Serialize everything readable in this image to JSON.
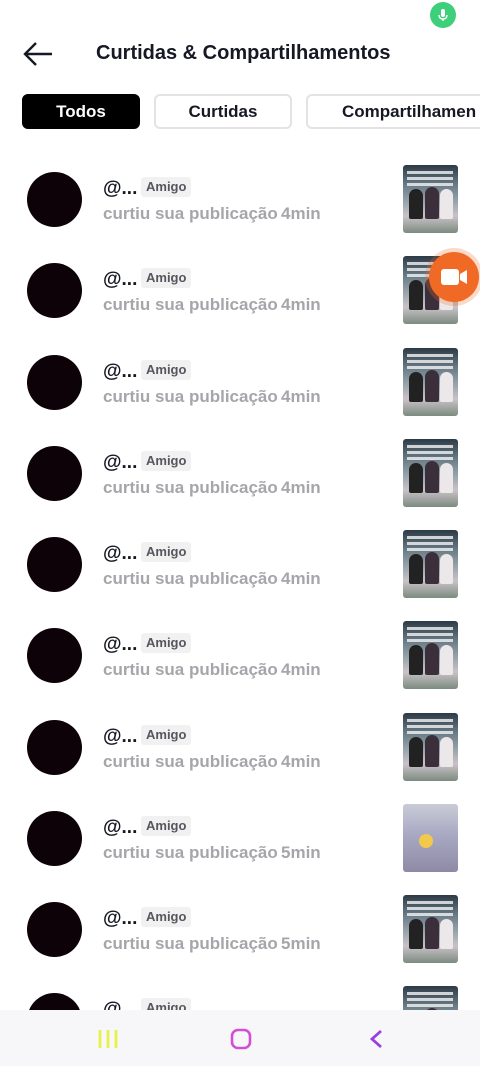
{
  "header": {
    "title": "Curtidas & Compartilhamentos"
  },
  "tabs": [
    {
      "label": "Todos",
      "active": true
    },
    {
      "label": "Curtidas",
      "active": false
    },
    {
      "label": "Compartilhamen",
      "active": false
    }
  ],
  "rows": [
    {
      "username": "@...",
      "badge": "Amigo",
      "action": "curtiu sua publicação",
      "time": "4min"
    },
    {
      "username": "@...",
      "badge": "Amigo",
      "action": "curtiu sua publicação",
      "time": "4min"
    },
    {
      "username": "@...",
      "badge": "Amigo",
      "action": "curtiu sua publicação",
      "time": "4min"
    },
    {
      "username": "@...",
      "badge": "Amigo",
      "action": "curtiu sua publicação",
      "time": "4min"
    },
    {
      "username": "@...",
      "badge": "Amigo",
      "action": "curtiu sua publicação",
      "time": "4min"
    },
    {
      "username": "@...",
      "badge": "Amigo",
      "action": "curtiu sua publicação",
      "time": "4min"
    },
    {
      "username": "@...",
      "badge": "Amigo",
      "action": "curtiu sua publicação",
      "time": "4min"
    },
    {
      "username": "@...",
      "badge": "Amigo",
      "action": "curtiu sua publicação",
      "time": "5min"
    },
    {
      "username": "@...",
      "badge": "Amigo",
      "action": "curtiu sua publicação",
      "time": "5min"
    },
    {
      "username": "@...",
      "badge": "Amigo",
      "action": "",
      "time": ""
    }
  ],
  "icons": {
    "back": "arrow-left-icon",
    "mic": "microphone-icon",
    "camera": "video-camera-icon",
    "nav_recents": "recent-apps-icon",
    "nav_home": "home-icon",
    "nav_back": "chevron-left-icon"
  },
  "colors": {
    "accent": "#f06a26",
    "mic_indicator": "#3ecf7a",
    "nav_recents": "#e8f23a",
    "nav_home": "#d14fd4",
    "nav_back": "#9a3ee0"
  }
}
